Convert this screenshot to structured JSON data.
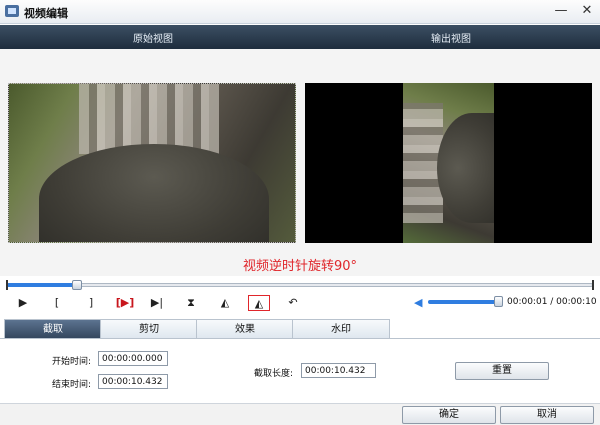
{
  "window": {
    "title": "视频编辑",
    "minimize": "—",
    "maximize": "□",
    "close": "✕"
  },
  "header": {
    "original_label": "原始视图",
    "output_label": "输出视图"
  },
  "annotation": "视频逆时针旋转90°",
  "seek": {
    "progress": 0.12
  },
  "controls": {
    "play": "▶",
    "mark_in": "[",
    "mark_out": "]",
    "play_selection": "[▶]",
    "prev": "▶|",
    "flip_v": "⧗",
    "rotate_cw": "◭",
    "rotate_ccw": "◭",
    "undo": "↶"
  },
  "volume": {
    "level": 1.0
  },
  "time": {
    "text": "00:00:01 / 00:00:10"
  },
  "tabs": [
    {
      "label": "截取",
      "active": true
    },
    {
      "label": "剪切",
      "active": false
    },
    {
      "label": "效果",
      "active": false
    },
    {
      "label": "水印",
      "active": false
    }
  ],
  "panel": {
    "start_label": "开始时间:",
    "start_value": "00:00:00.000",
    "end_label": "结束时间:",
    "end_value": "00:00:10.432",
    "length_label": "截取长度:",
    "length_value": "00:00:10.432",
    "reset_label": "重置"
  },
  "footer": {
    "ok_label": "确定",
    "cancel_label": "取消"
  }
}
